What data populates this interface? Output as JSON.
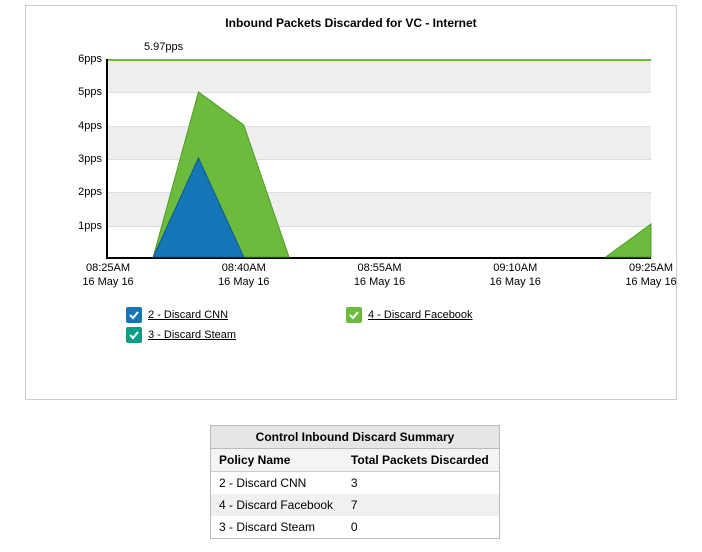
{
  "chart_data": {
    "type": "area",
    "title": "Inbound Packets Discarded for VC - Internet",
    "xlabel": "",
    "ylabel": "",
    "x_ticks": [
      {
        "time": "08:25AM",
        "date": "16 May 16"
      },
      {
        "time": "08:40AM",
        "date": "16 May 16"
      },
      {
        "time": "08:55AM",
        "date": "16 May 16"
      },
      {
        "time": "09:10AM",
        "date": "16 May 16"
      },
      {
        "time": "09:25AM",
        "date": "16 May 16"
      }
    ],
    "y_ticks": [
      "1pps",
      "2pps",
      "3pps",
      "4pps",
      "5pps",
      "6pps"
    ],
    "ylim": [
      0,
      6
    ],
    "annotation": "5.97pps",
    "x": [
      "08:25",
      "08:30",
      "08:35",
      "08:40",
      "08:45",
      "08:50",
      "08:55",
      "09:00",
      "09:05",
      "09:10",
      "09:15",
      "09:20",
      "09:25"
    ],
    "series": [
      {
        "name": "2 - Discard CNN",
        "color": "#1476b6",
        "values": [
          0,
          0,
          3,
          0,
          0,
          0,
          0,
          0,
          0,
          0,
          0,
          0,
          0
        ]
      },
      {
        "name": "3 - Discard Steam",
        "color": "#0e9e88",
        "values": [
          0,
          0,
          0,
          0,
          0,
          0,
          0,
          0,
          0,
          0,
          0,
          0,
          0
        ]
      },
      {
        "name": "4 - Discard Facebook",
        "color": "#6cbb3c",
        "values": [
          0,
          0,
          5,
          4,
          0,
          0,
          0,
          0,
          0,
          0,
          0,
          0,
          1
        ]
      }
    ],
    "legend": [
      {
        "label": "2 - Discard CNN",
        "color": "#1476b6"
      },
      {
        "label": "4 - Discard Facebook",
        "color": "#6cbb3c"
      },
      {
        "label": "3 - Discard Steam",
        "color": "#0e9e88"
      }
    ]
  },
  "summary": {
    "caption": "Control Inbound Discard Summary",
    "headers": [
      "Policy Name",
      "Total Packets Discarded"
    ],
    "rows": [
      {
        "policy": "2 - Discard CNN",
        "total": "3"
      },
      {
        "policy": "4 - Discard Facebook",
        "total": "7"
      },
      {
        "policy": "3 - Discard Steam",
        "total": "0"
      }
    ]
  }
}
